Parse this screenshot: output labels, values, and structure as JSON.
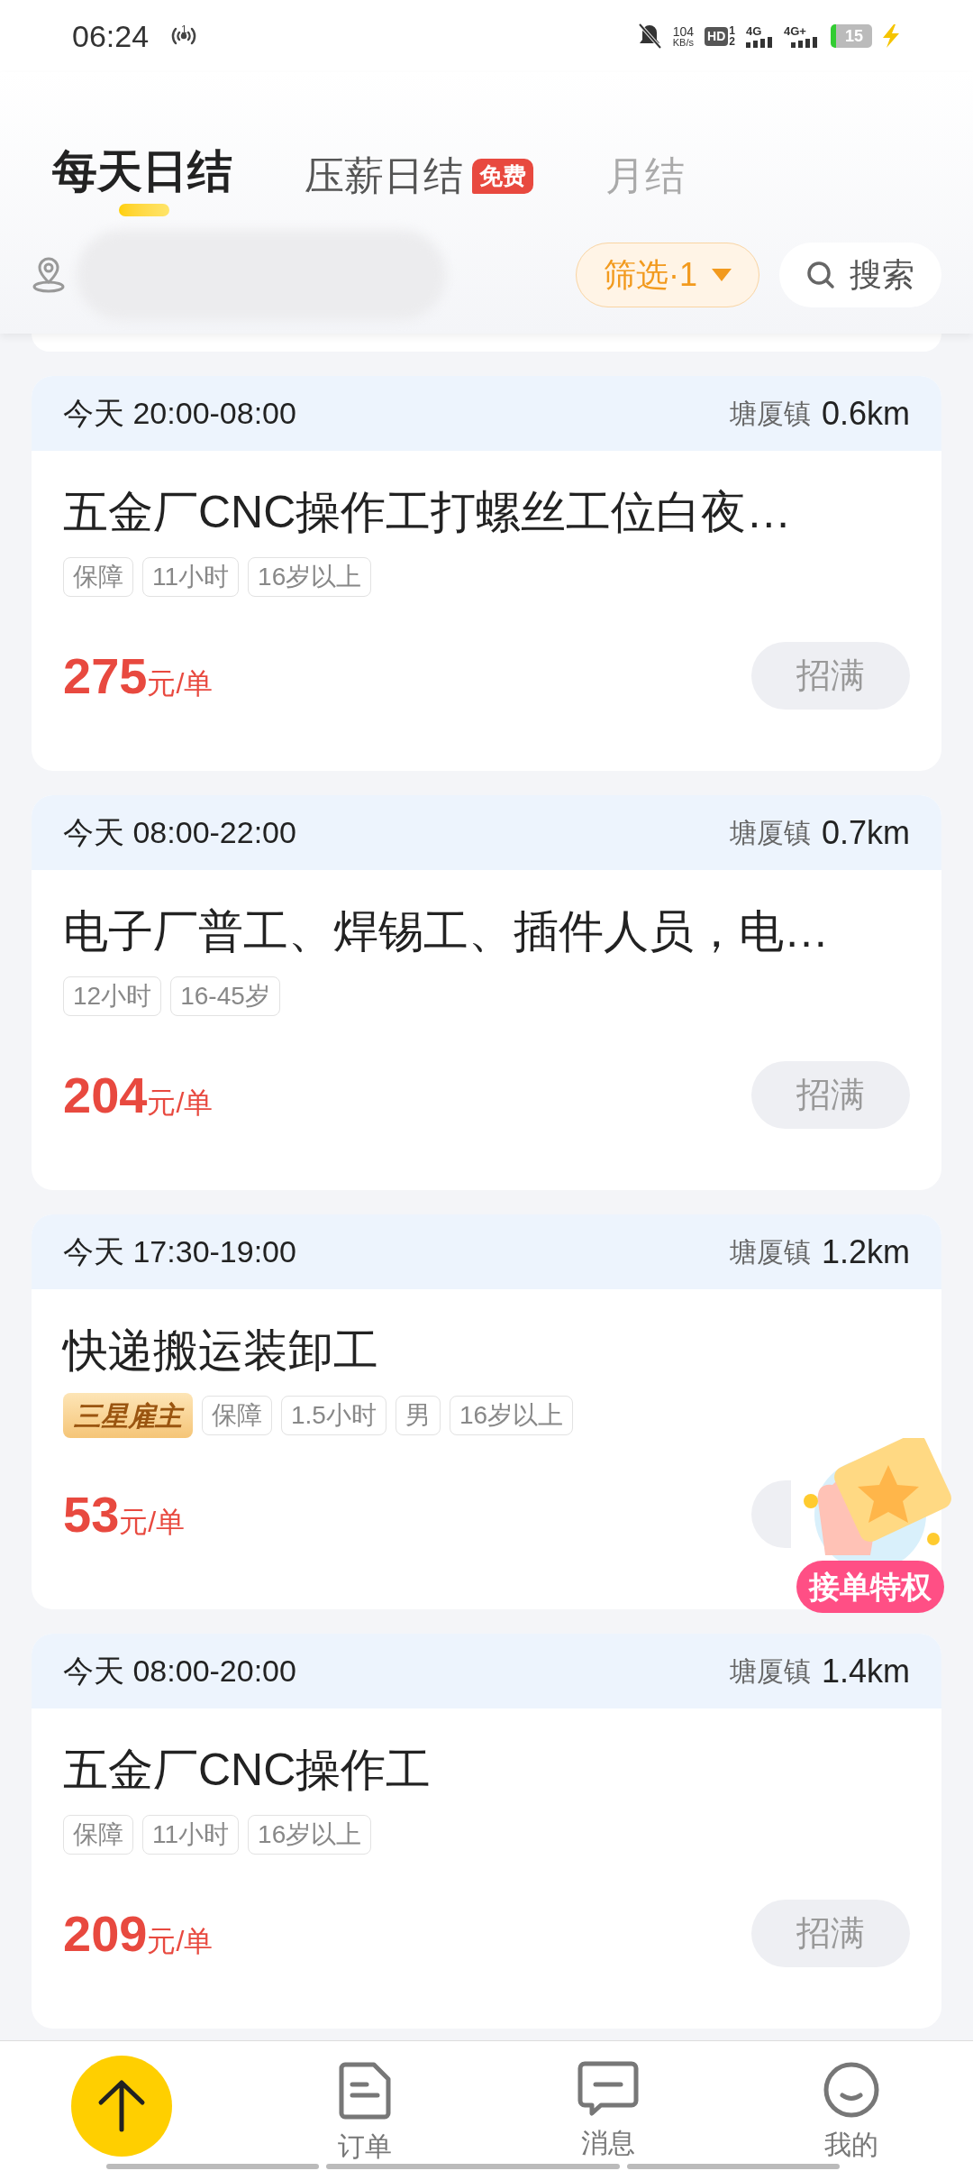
{
  "status_bar": {
    "time": "06:24",
    "hotspot_count": "1",
    "net_speed": "104",
    "net_unit": "KB/s",
    "hd": "HD",
    "hd_sup": "1",
    "hd_sub": "2",
    "sim1": "4G",
    "sim2": "4G+",
    "battery": "15"
  },
  "tabs": [
    {
      "label": "每天日结",
      "selected": true
    },
    {
      "label": "压薪日结",
      "selected": false,
      "badge": "免费"
    },
    {
      "label": "月结",
      "selected": false
    }
  ],
  "filter": {
    "label": "筛选·1",
    "active": true
  },
  "search": {
    "label": "搜索"
  },
  "jobs": [
    {
      "day": "今天",
      "time": "20:00-08:00",
      "town": "塘厦镇",
      "distance": "0.6km",
      "title": "五金厂CNC操作工打螺丝工位白夜…",
      "tags": [
        {
          "text": "保障",
          "kind": "plain"
        },
        {
          "text": "11小时",
          "kind": "plain"
        },
        {
          "text": "16岁以上",
          "kind": "plain"
        }
      ],
      "price": "275",
      "unit": "元/单",
      "button": "招满"
    },
    {
      "day": "今天",
      "time": "08:00-22:00",
      "town": "塘厦镇",
      "distance": "0.7km",
      "title": "电子厂普工、焊锡工、插件人员，电…",
      "tags": [
        {
          "text": "12小时",
          "kind": "plain"
        },
        {
          "text": "16-45岁",
          "kind": "plain"
        }
      ],
      "price": "204",
      "unit": "元/单",
      "button": "招满"
    },
    {
      "day": "今天",
      "time": "17:30-19:00",
      "town": "塘厦镇",
      "distance": "1.2km",
      "title": "快递搬运装卸工",
      "tags": [
        {
          "text": "三星雇主",
          "kind": "rank"
        },
        {
          "text": "保障",
          "kind": "plain"
        },
        {
          "text": "1.5小时",
          "kind": "plain"
        },
        {
          "text": "男",
          "kind": "plain"
        },
        {
          "text": "16岁以上",
          "kind": "plain"
        }
      ],
      "price": "53",
      "unit": "元/单"
    },
    {
      "day": "今天",
      "time": "08:00-20:00",
      "town": "塘厦镇",
      "distance": "1.4km",
      "title": "五金厂CNC操作工",
      "tags": [
        {
          "text": "保障",
          "kind": "plain"
        },
        {
          "text": "11小时",
          "kind": "plain"
        },
        {
          "text": "16岁以上",
          "kind": "plain"
        }
      ],
      "price": "209",
      "unit": "元/单",
      "button": "招满"
    }
  ],
  "promo": {
    "label": "接单特权"
  },
  "bottom_nav": [
    {
      "kind": "top",
      "selected": false
    },
    {
      "kind": "tab",
      "label": "订单",
      "selected": false
    },
    {
      "kind": "tab",
      "label": "消息",
      "selected": false
    },
    {
      "kind": "tab",
      "label": "我的",
      "selected": false
    }
  ]
}
